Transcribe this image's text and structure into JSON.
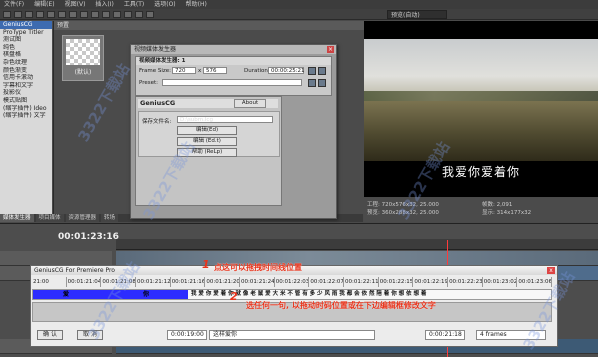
{
  "menu": [
    "文件(F)",
    "编辑(E)",
    "视图(V)",
    "插入(I)",
    "工具(T)",
    "选项(O)",
    "帮助(H)"
  ],
  "preview_mode": "预览(自动)",
  "left_panel": {
    "items": [
      "GeniusCG",
      "ProType Titler",
      "测试图",
      "纯色",
      "棋盘格",
      "杂色纹理",
      "颜色渐变",
      "信用卡滚动",
      "字幕和文字",
      "投影仪",
      "模式贴图",
      "(缩字插件) Ideo",
      "(缩字插件) 文字"
    ]
  },
  "media": {
    "header": "预置",
    "thumb_caption": "(默认)"
  },
  "pane_tabs": [
    "媒体发生器",
    "项目媒体",
    "资源管理器",
    "转场"
  ],
  "dialog": {
    "title": "视频媒体发生器",
    "props_header": "视频媒体发生器: 1",
    "frame_size_label": "Frame Size:",
    "frame_w": "720",
    "frame_x": "x",
    "frame_h": "576",
    "duration_label": "Duration:",
    "duration_value": "00:00:25:21",
    "preset_label": "Preset:",
    "plugin_name": "GeniusCG",
    "about_label": "About",
    "file_label": "保存文件名:",
    "file_value": "D:\\subm.lcg",
    "btn_edit": "编辑(Ed)",
    "btn_import": "编辑 (Ed.t)",
    "btn_help": "帮助 (ReLp)"
  },
  "video": {
    "subtitle": "我爱你爱着你",
    "info_left": [
      "工程: 720x576x32, 25.000",
      "预览: 360x288x32, 25.000"
    ],
    "info_right": [
      "帧数: 2,091",
      "显示: 314x177x32"
    ]
  },
  "timeline": {
    "timecode": "00:01:23:16"
  },
  "genius_premiere": {
    "title": "GeniusCG For Premiere Pro",
    "close": "x",
    "timecodes": [
      "21:00",
      "00:01:21:04",
      "00:01:21:08",
      "00:01:21:12",
      "00:01:21:16",
      "00:01:21:20",
      "00:01:21:24",
      "00:01:22:03",
      "00:01:22:07",
      "00:01:22:11",
      "00:01:22:15",
      "00:01:22:19",
      "00:01:22:23",
      "00:01:23:02",
      "00:01:23:06"
    ],
    "blue_text_1": "爱",
    "blue_text_2": "你",
    "subs": "我 爱 你 爱 着 你        就 像 老 鼠 爱 大 米      不 管 有 多 少 风 雨 我 都 会 依 然 陪 着 你      想 依 想 着",
    "btn_ok": "确 认",
    "btn_cancel": "取 消",
    "tc_start": "0:00:19:00",
    "line_text": "这样爱你",
    "tc_end": "0:00:21:18",
    "frames": "4 frames"
  },
  "annotations": {
    "num1": "1",
    "text1": "点这可以拖拽时间线位置",
    "num2": "2",
    "text2": "选任何一句, 以拖动时码位置或在下边编辑框修改文字"
  },
  "watermark": "3322下载站"
}
